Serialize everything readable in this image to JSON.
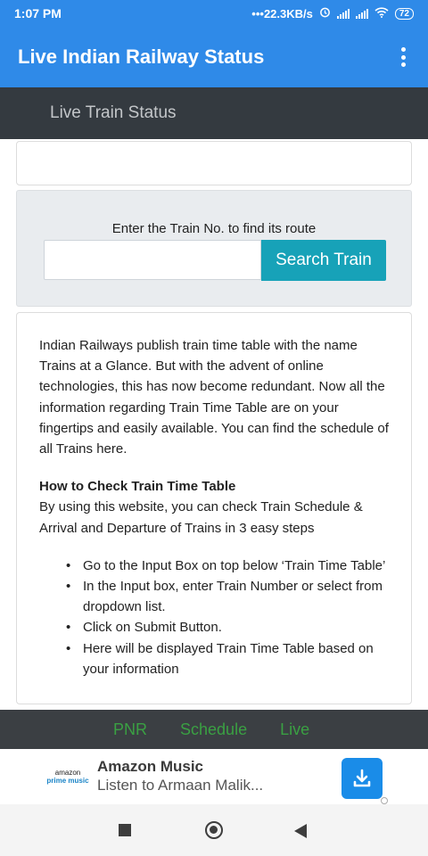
{
  "status_bar": {
    "time": "1:07 PM",
    "network_speed": "22.3KB/s",
    "battery": "72"
  },
  "app_bar": {
    "title": "Live Indian Railway Status",
    "menu_icon": "overflow-menu-icon"
  },
  "nav": {
    "link": "Live Train Status"
  },
  "search": {
    "prompt": "Enter the Train No. to find its route",
    "input_value": "",
    "placeholder": "",
    "button_label": "Search Train"
  },
  "content": {
    "intro": "Indian Railways publish train time table with the name Trains at a Glance. But with the advent of online technologies, this has now become redundant. Now all the information regarding Train Time Table are on your fingertips and easily available. You can find the schedule of all Trains here.",
    "how_title": "How to Check Train Time Table",
    "how_text": "By using this website, you can check Train Schedule & Arrival and Departure of Trains in 3 easy steps",
    "steps": [
      "Go to the Input Box on top below ‘Train Time Table’",
      "In the Input box, enter Train Number or select from dropdown list.",
      "Click on Submit Button.",
      "Here will be displayed Train Time Table based on your information"
    ]
  },
  "bottom_tabs": [
    "PNR",
    "Schedule",
    "Live"
  ],
  "ad": {
    "logo_line1": "amazon",
    "logo_line2": "prime music",
    "title": "Amazon Music",
    "subtitle": "Listen to Armaan Malik...",
    "button_icon": "download-icon"
  },
  "colors": {
    "app_bar": "#2f8ae8",
    "nav_bar": "#343a40",
    "search_button": "#17a2b8",
    "tab_text": "#3aa043"
  }
}
